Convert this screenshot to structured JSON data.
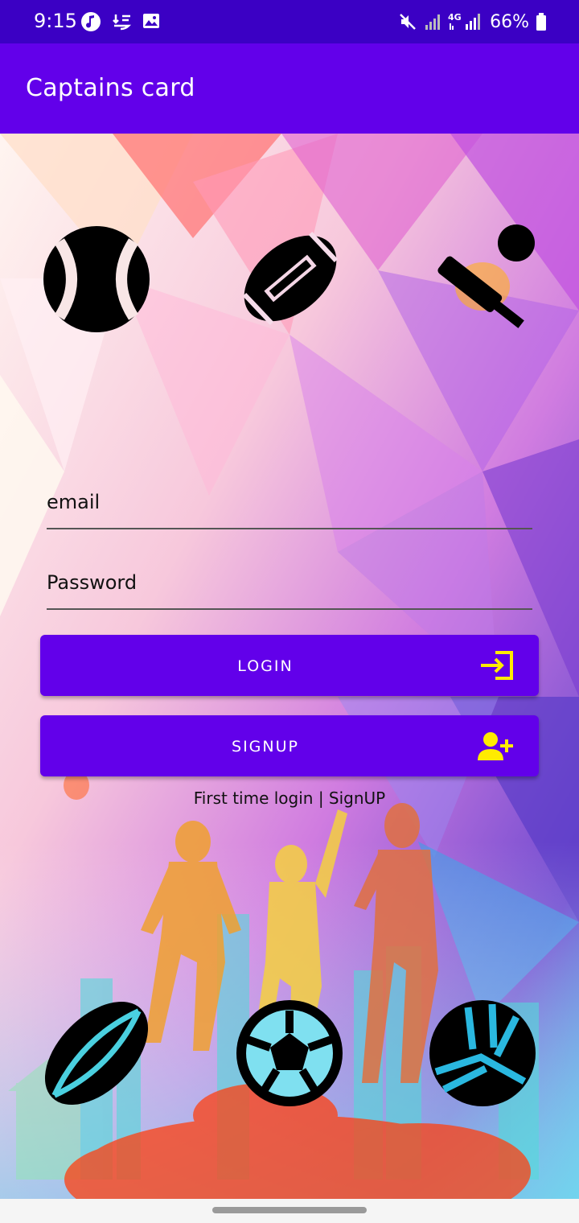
{
  "status_bar": {
    "time": "9:15",
    "battery_percent": "66%",
    "network": "4G",
    "icons_left": [
      "music-note-icon",
      "download-transfer-icon",
      "image-icon"
    ],
    "icons_right": [
      "mute-icon",
      "signal-icon",
      "4g-signal-icon",
      "battery-icon"
    ]
  },
  "app_bar": {
    "title": "Captains card",
    "color": "#6200ea"
  },
  "login_form": {
    "email_label": "email",
    "password_label": "Password",
    "login_button": "LOGIN",
    "signup_button": "SIGNUP",
    "hint_text": "First time login | SignUP"
  },
  "icons": {
    "top": [
      "tennis-ball-icon",
      "american-football-icon",
      "cricket-bat-ball-icon"
    ],
    "bottom": [
      "rugby-ball-icon",
      "soccer-ball-icon",
      "volleyball-icon"
    ],
    "login_icon": "login-arrow-icon",
    "signup_icon": "add-user-icon",
    "accent": "#ffeb00"
  },
  "colors": {
    "primary": "#6200ea",
    "status_bar": "#3b00c4"
  }
}
